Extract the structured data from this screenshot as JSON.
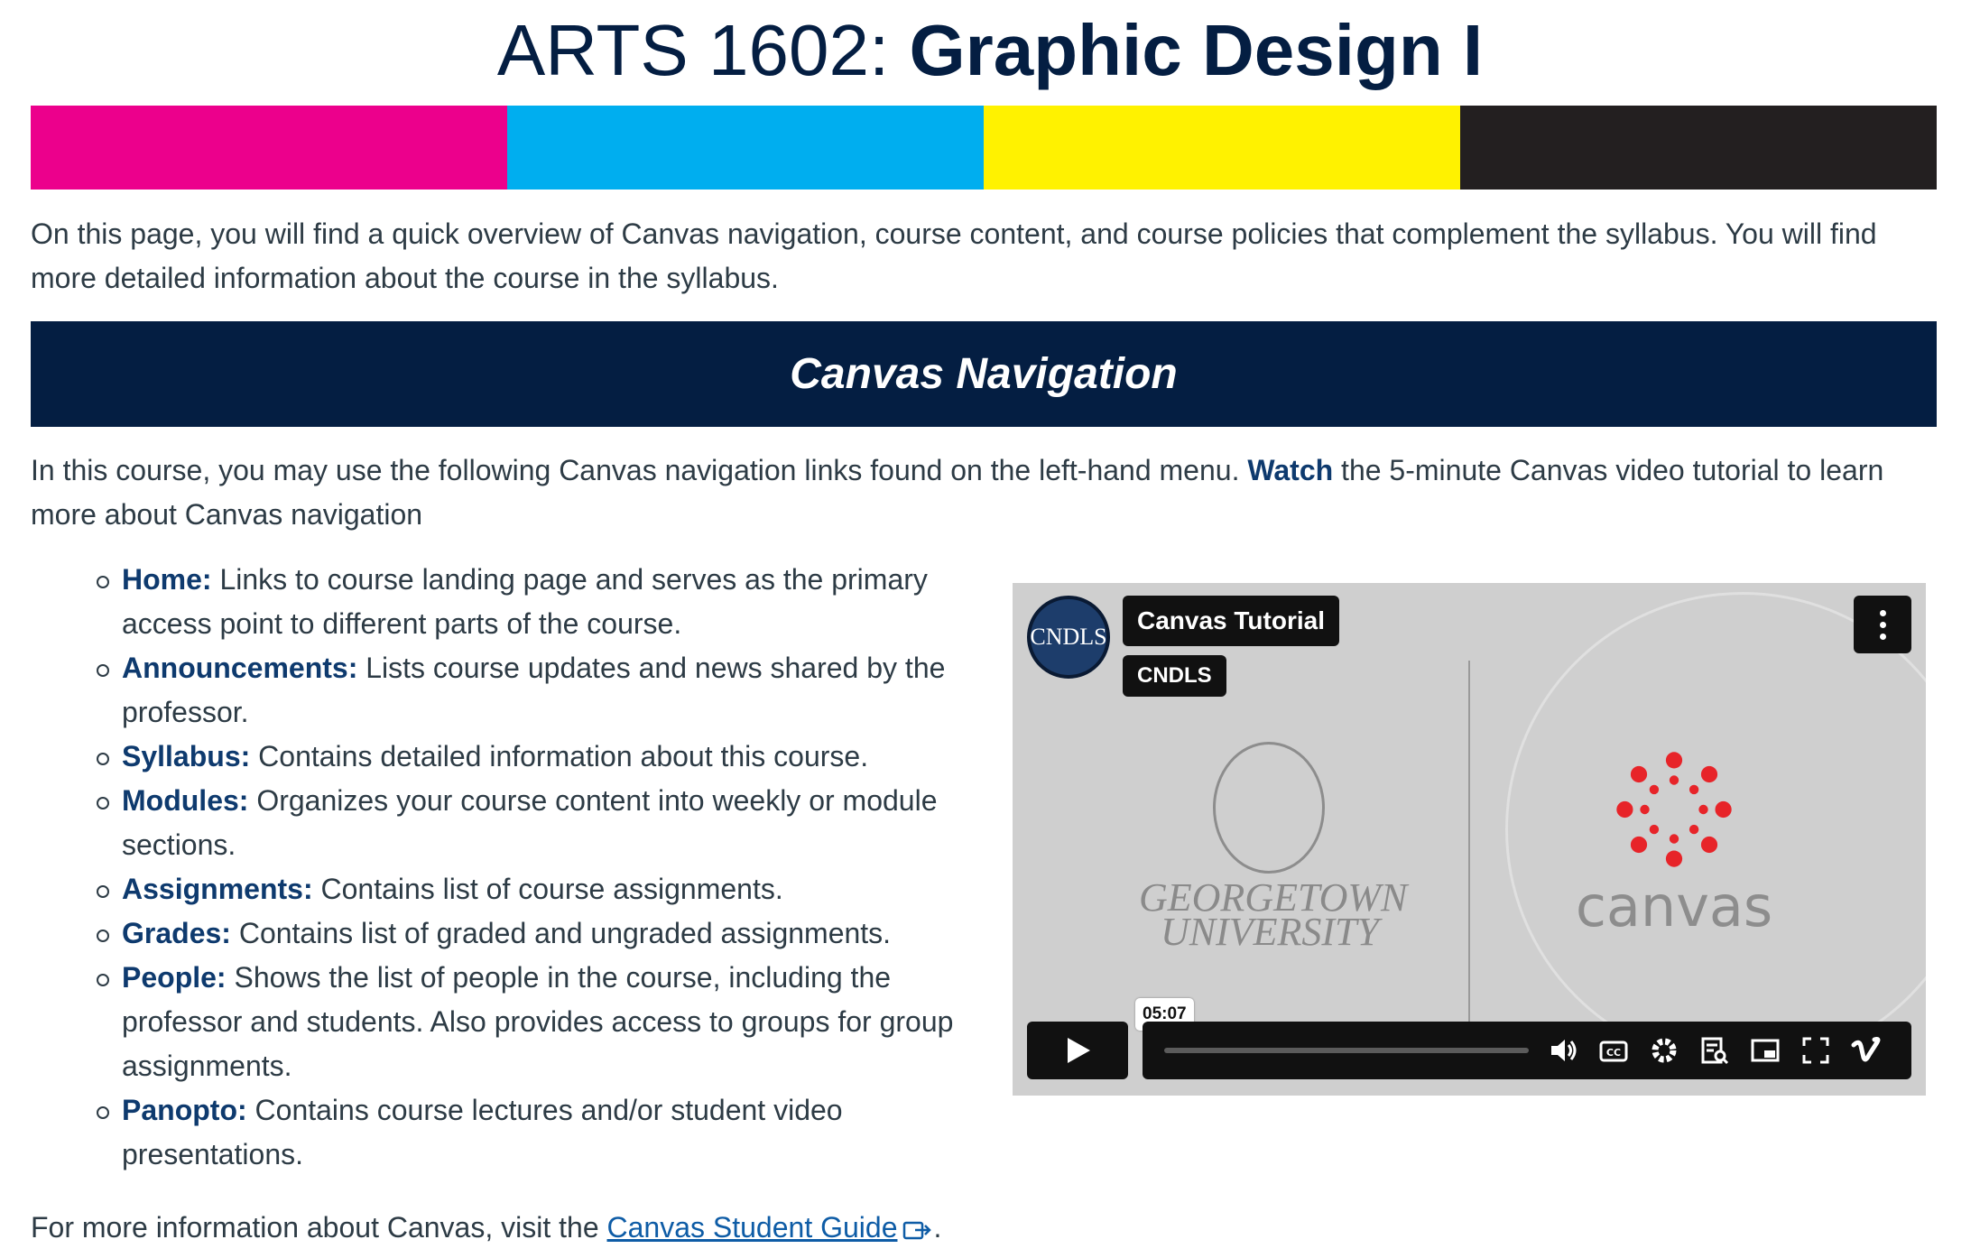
{
  "title": {
    "prefix": "ARTS 1602:",
    "bold": "Graphic Design I"
  },
  "colorbar": [
    "#ec008c",
    "#00aeef",
    "#fff200",
    "#231f20"
  ],
  "intro": "On this page, you will find a quick overview of Canvas navigation, course content, and course policies that complement the syllabus. You will find more detailed information about the course in the syllabus.",
  "section": {
    "heading": "Canvas Navigation",
    "lead_before": "In this course, you may use the following Canvas navigation links found on the left-hand menu. ",
    "lead_link": "Watch",
    "lead_after": " the 5-minute Canvas video tutorial to learn more about Canvas navigation"
  },
  "nav_items": [
    {
      "term": "Home:",
      "desc": " Links to course landing page and serves as the primary access point to different parts of the course."
    },
    {
      "term": "Announcements:",
      "desc": " Lists course updates and news shared by the professor."
    },
    {
      "term": "Syllabus:",
      "desc": " Contains detailed information about this course."
    },
    {
      "term": "Modules:",
      "desc": " Organizes your course content into weekly or module sections."
    },
    {
      "term": "Assignments:",
      "desc": " Contains list of course assignments."
    },
    {
      "term": "Grades:",
      "desc": " Contains list of graded and ungraded assignments."
    },
    {
      "term": "People:",
      "desc": " Shows the list of people in the course, including the professor and students. Also provides access to groups for group assignments."
    },
    {
      "term": "Panopto:",
      "desc": " Contains course lectures and/or student video presentations."
    }
  ],
  "video": {
    "title": "Canvas Tutorial",
    "owner": "CNDLS",
    "avatar_text": "CNDLS",
    "gu_name_line1": "GEORGETOWN",
    "gu_name_line2": "UNIVERSITY",
    "canvas_word": "canvas",
    "duration": "05:07",
    "icons": [
      "play-icon",
      "volume-icon",
      "captions-icon",
      "settings-icon",
      "transcript-icon",
      "pip-icon",
      "fullscreen-icon",
      "vimeo-icon"
    ]
  },
  "footer": {
    "before": "For more information about Canvas, visit the ",
    "link": "Canvas Student Guide",
    "after": "."
  }
}
